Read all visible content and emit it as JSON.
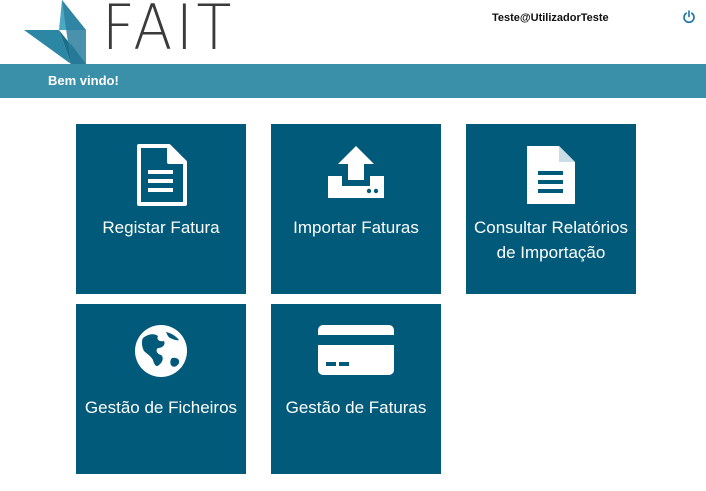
{
  "header": {
    "logo_text": "FAIT",
    "user": "Teste@UtilizadorTeste"
  },
  "welcome": {
    "text": "Bem vindo!"
  },
  "tiles": [
    {
      "label": "Registar Fatura",
      "icon": "document-icon"
    },
    {
      "label": "Importar Faturas",
      "icon": "upload-icon"
    },
    {
      "label_lines": [
        "Consultar Relatórios",
        "de Importação"
      ],
      "icon": "report-document-icon"
    },
    {
      "label": "Gestão de Ficheiros",
      "icon": "globe-icon"
    },
    {
      "label": "Gestão de Faturas",
      "icon": "credit-card-icon"
    }
  ],
  "colors": {
    "tile": "#015a7a",
    "welcome_bar": "#3a8fa9",
    "logo_dark": "#1d6d88",
    "logo_light": "#4aa3bd"
  }
}
